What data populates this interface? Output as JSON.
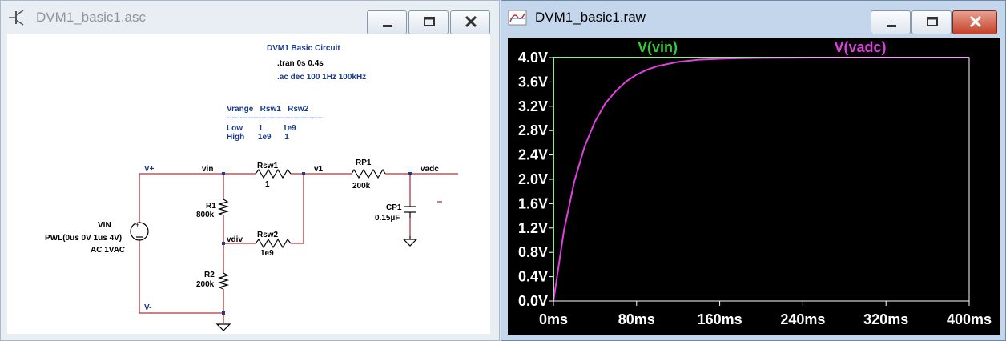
{
  "schematic_window": {
    "title": "DVM1_basic1.asc",
    "heading": "DVM1 Basic Circuit",
    "directives": [
      ".tran 0s 0.4s",
      ".ac dec 100 1Hz 100kHz"
    ],
    "table": {
      "header": "Vrange   Rsw1   Rsw2",
      "rule": "------------------------------------",
      "rows": [
        "Low       1         1e9",
        "High      1e9      1"
      ]
    },
    "nets": {
      "vplus": "V+",
      "vminus": "V-",
      "vin": "vin",
      "v1": "v1",
      "vadc": "vadc",
      "vdiv": "vdiv"
    },
    "components": {
      "vin_name": "VIN",
      "vin_value": "PWL(0us 0V 1us 4V)",
      "vin_ac": "AC 1VAC",
      "rsw1_name": "Rsw1",
      "rsw1_value": "1",
      "rp1_name": "RP1",
      "rp1_value": "200k",
      "r1_name": "R1",
      "r1_value": "800k",
      "rsw2_name": "Rsw2",
      "rsw2_value": "1e9",
      "r2_name": "R2",
      "r2_value": "200k",
      "cp1_name": "CP1",
      "cp1_value": "0.15µF"
    },
    "marker": "-"
  },
  "waveform_window": {
    "title": "DVM1_basic1.raw"
  },
  "chart_data": {
    "type": "line",
    "title": "",
    "xlabel": "",
    "ylabel": "",
    "xlim": [
      0,
      400
    ],
    "ylim": [
      0,
      4.0
    ],
    "x_unit": "ms",
    "x_ticks": [
      "0ms",
      "80ms",
      "160ms",
      "240ms",
      "320ms",
      "400ms"
    ],
    "y_ticks": [
      "0.0V",
      "0.4V",
      "0.8V",
      "1.2V",
      "1.6V",
      "2.0V",
      "2.4V",
      "2.8V",
      "3.2V",
      "3.6V",
      "4.0V"
    ],
    "grid": false,
    "series": [
      {
        "name": "V(vin)",
        "color": "#33cc33",
        "x": [
          0,
          0.001,
          400
        ],
        "y": [
          0,
          4.0,
          4.0
        ]
      },
      {
        "name": "V(vadc)",
        "color": "#e040e0",
        "x": [
          0,
          10,
          20,
          30,
          40,
          50,
          60,
          70,
          80,
          90,
          100,
          120,
          140,
          160,
          180,
          200,
          240,
          280,
          320,
          360,
          400
        ],
        "y": [
          0,
          1.15,
          1.96,
          2.54,
          2.95,
          3.25,
          3.45,
          3.61,
          3.72,
          3.8,
          3.86,
          3.93,
          3.965,
          3.98,
          3.99,
          3.995,
          3.999,
          4.0,
          4.0,
          4.0,
          4.0
        ]
      }
    ],
    "colors": {
      "background": "#000000",
      "axis": "#ffffff"
    }
  }
}
